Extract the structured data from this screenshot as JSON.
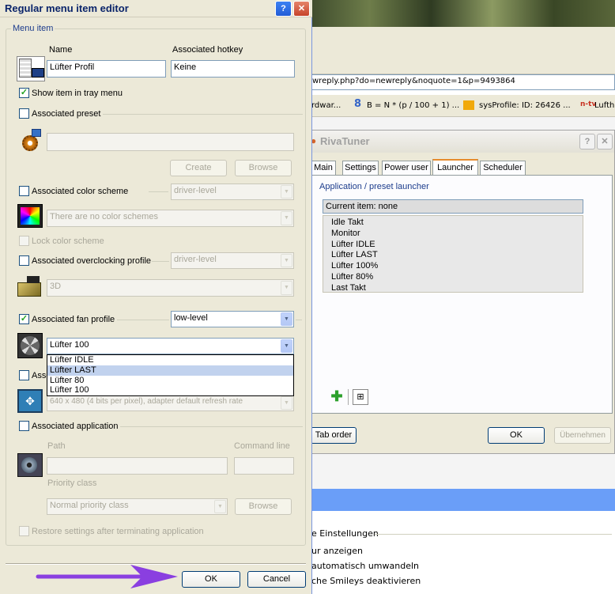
{
  "editor": {
    "title": "Regular menu item editor",
    "group_label": "Menu item",
    "name_label": "Name",
    "hotkey_label": "Associated hotkey",
    "name_value": "Lüfter Profil",
    "hotkey_value": "Keine",
    "show_tray_label": "Show item in tray menu",
    "preset_label": "Associated preset",
    "create_label": "Create",
    "browse_label": "Browse",
    "color_scheme_label": "Associated color scheme",
    "color_scheme_level": "driver-level",
    "color_scheme_value": "There are no color schemes",
    "lock_color_label": "Lock color scheme",
    "oc_label": "Associated overclocking profile",
    "oc_level": "driver-level",
    "oc_value": "3D",
    "fan_label": "Associated fan profile",
    "fan_level": "low-level",
    "fan_value": "Lüfter 100",
    "fan_options": [
      "Lüfter IDLE",
      "Lüfter LAST",
      "Lüfter 80",
      "Lüfter 100"
    ],
    "fan_highlighted": "Lüfter LAST",
    "video_label_partial": "Asso",
    "video_value": "640 x 480 (4 bits per pixel), adapter default refresh rate",
    "app_label": "Associated application",
    "path_label": "Path",
    "cmdline_label": "Command line",
    "priority_label": "Priority class",
    "priority_value": "Normal priority class",
    "restore_label": "Restore settings after terminating application",
    "ok_label": "OK",
    "cancel_label": "Cancel"
  },
  "browser": {
    "url": "wreply.php?do=newreply&noquote=1&p=9493864",
    "bookmarks": [
      "rdwar...",
      "B = N * (p / 100 + 1) ...",
      "sysProfile: ID: 26426 ...",
      "Lufthar"
    ]
  },
  "riva": {
    "title": "RivaTuner",
    "tabs": [
      "Main",
      "Settings",
      "Power user",
      "Launcher",
      "Scheduler"
    ],
    "active_tab": "Launcher",
    "group_label": "Application / preset launcher",
    "current_item": "Current item: none",
    "items": [
      "Idle Takt",
      "Monitor",
      "Lüfter IDLE",
      "Lüfter LAST",
      "Lüfter 100%",
      "Lüfter 80%",
      "Last Takt"
    ],
    "tab_order_label": "Tab order",
    "ok_label": "OK",
    "apply_label": "Übernehmen"
  },
  "forum": {
    "settings_label": "e Einstellungen",
    "options": [
      "ur anzeigen",
      "automatisch umwandeln",
      "che Smileys deaktivieren"
    ]
  },
  "colors": {
    "xp_blue": "#0a246a",
    "annotation_arrow": "#8a3fe0",
    "selection": "#c1d2ee"
  }
}
